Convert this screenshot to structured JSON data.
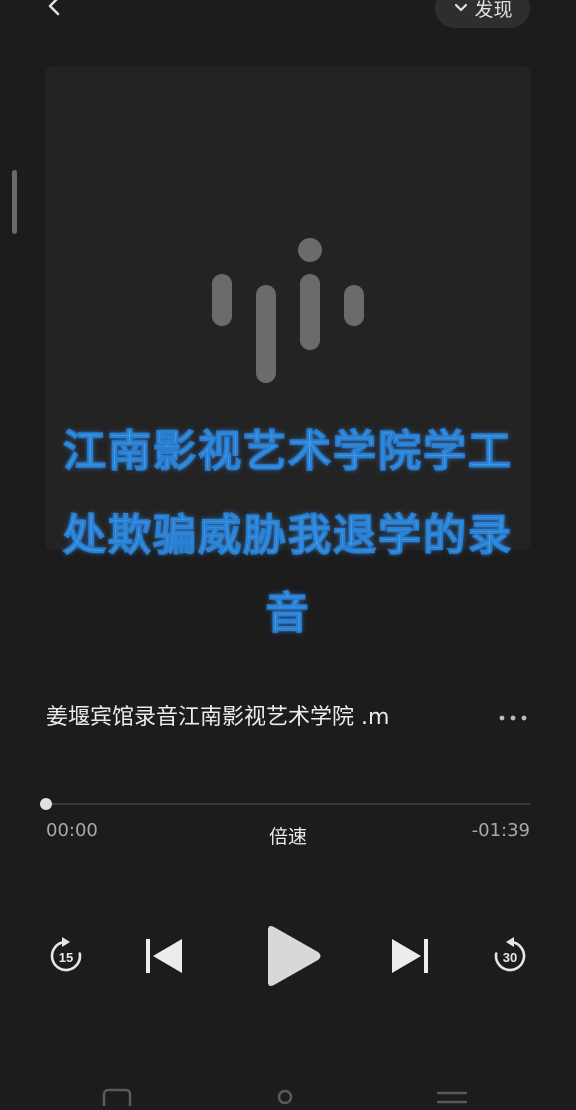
{
  "header": {
    "back_icon": "chevron-left-icon",
    "discover_label": "发现",
    "discover_icon": "chevron-down-icon"
  },
  "artwork": {
    "icon": "audio-waveform-icon"
  },
  "overlay": {
    "lines": [
      "江南影视艺术学院学工",
      "处欺骗威胁我退学的录",
      "音"
    ],
    "color": "#3fa0f0"
  },
  "track": {
    "title": "姜堰宾馆录音江南影视艺术学院 .m",
    "more_icon": "more-horizontal-icon"
  },
  "progress": {
    "value": 0,
    "elapsed": "00:00",
    "remaining": "-01:39",
    "speed_label": "倍速"
  },
  "controls": {
    "rewind_icon": "rewind-15-icon",
    "rewind_seconds": "15",
    "previous_icon": "skip-previous-icon",
    "play_icon": "play-icon",
    "next_icon": "skip-next-icon",
    "forward_icon": "forward-30-icon",
    "forward_seconds": "30"
  },
  "system_nav": {
    "recents_icon": "square-icon",
    "home_icon": "circle-icon",
    "menu_icon": "menu-icon"
  }
}
